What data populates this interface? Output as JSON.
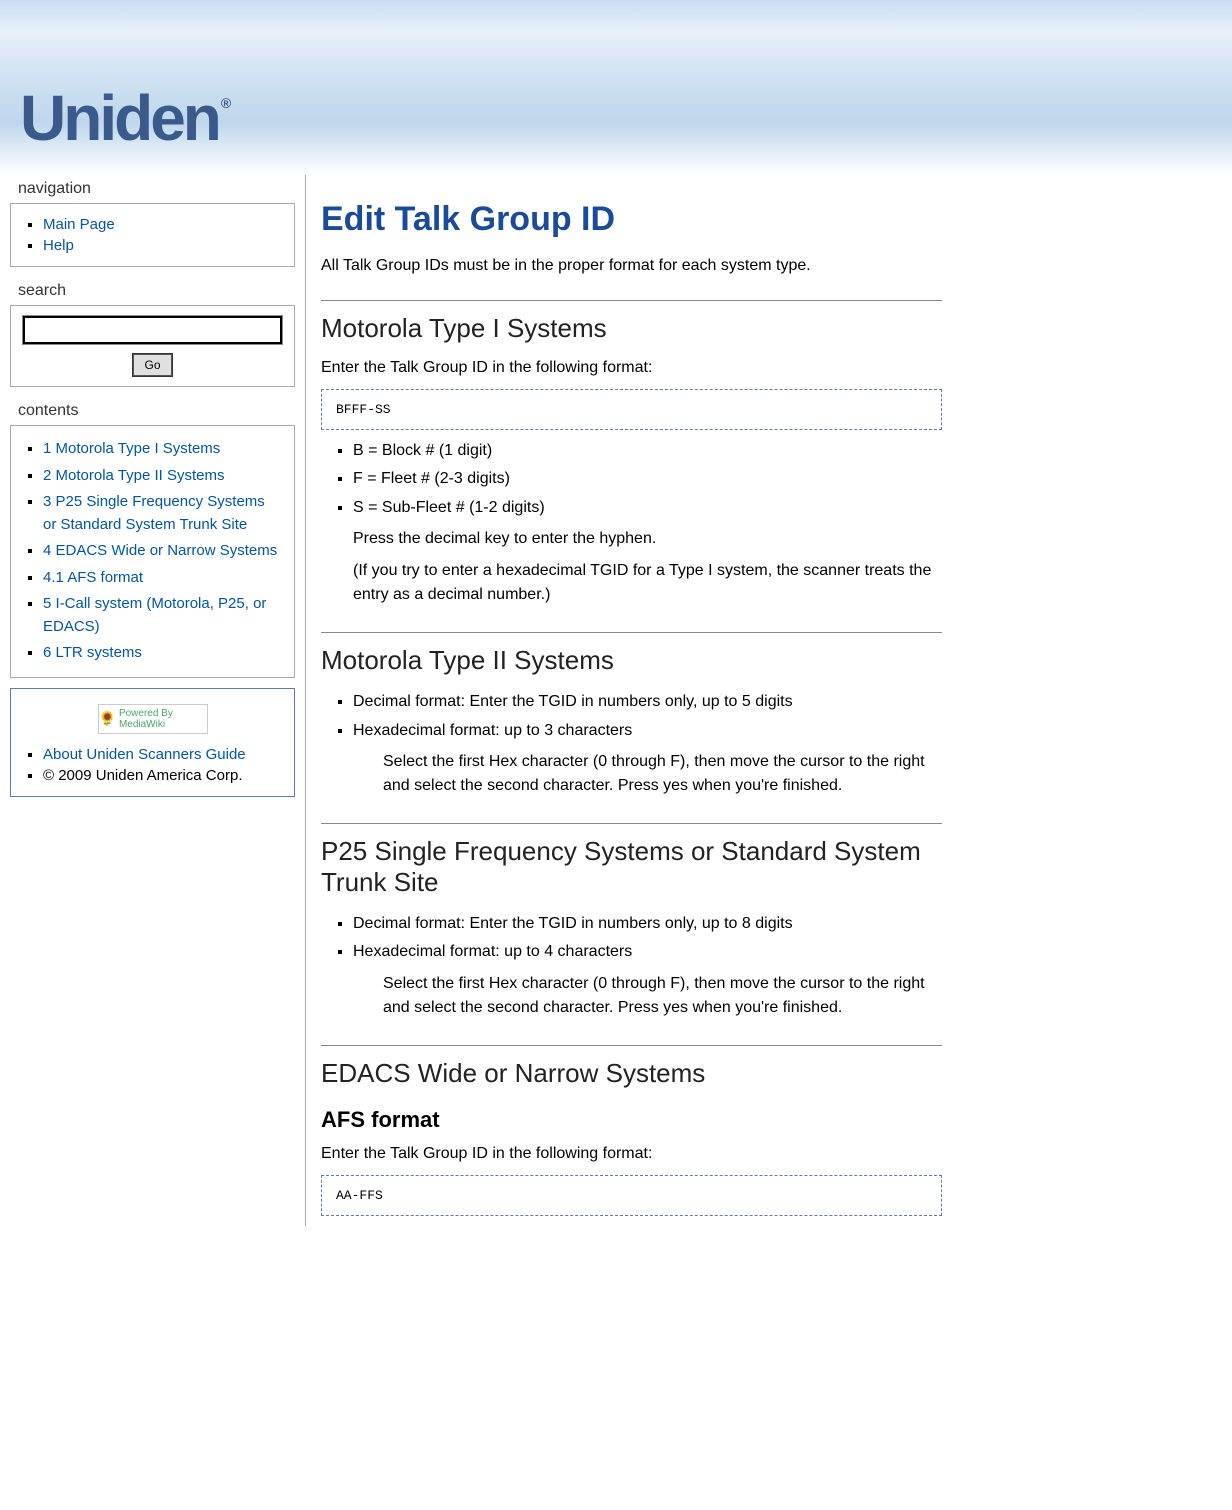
{
  "logo": "Uniden",
  "nav": {
    "heading": "navigation",
    "items": [
      "Main Page",
      "Help"
    ]
  },
  "search": {
    "heading": "search",
    "go": "Go"
  },
  "toc": {
    "heading": "contents",
    "items": [
      "1 Motorola Type I Systems",
      "2 Motorola Type II Systems",
      "3 P25 Single Frequency Systems or Standard System Trunk Site",
      "4 EDACS Wide or Narrow Systems",
      "4.1 AFS format",
      "5 I-Call system (Motorola, P25, or EDACS)",
      "6 LTR systems"
    ]
  },
  "footer": {
    "badge": "Powered By MediaWiki",
    "about": "About Uniden Scanners Guide",
    "copyright": "© 2009 Uniden America Corp."
  },
  "page": {
    "title": "Edit Talk Group ID",
    "intro": "All Talk Group IDs must be in the proper format for each system type.",
    "s1": {
      "heading": "Motorola Type I Systems",
      "lead": "Enter the Talk Group ID in the following format:",
      "code": "BFFF-SS",
      "b1": "B = Block # (1 digit)",
      "b2": "F = Fleet # (2-3 digits)",
      "b3": "S = Sub-Fleet # (1-2 digits)",
      "note1": "Press the decimal key to enter the hyphen.",
      "note2": "(If you try to enter a hexadecimal TGID for a Type I system, the scanner treats the entry as a decimal number.)"
    },
    "s2": {
      "heading": "Motorola Type II Systems",
      "b1": "Decimal format: Enter the TGID in numbers only, up to 5 digits",
      "b2": "Hexadecimal format: up to 3 characters",
      "note": "Select the first Hex character (0 through F), then move the cursor to the right and select the second character. Press yes when you're finished."
    },
    "s3": {
      "heading": "P25 Single Frequency Systems or Standard System Trunk Site",
      "b1": "Decimal format: Enter the TGID in numbers only, up to 8 digits",
      "b2": "Hexadecimal format: up to 4 characters",
      "note": "Select the first Hex character (0 through F), then move the cursor to the right and select the second character. Press yes when you're finished."
    },
    "s4": {
      "heading": "EDACS Wide or Narrow Systems",
      "sub": "AFS format",
      "lead": "Enter the Talk Group ID in the following format:",
      "code": "AA-FFS"
    }
  }
}
